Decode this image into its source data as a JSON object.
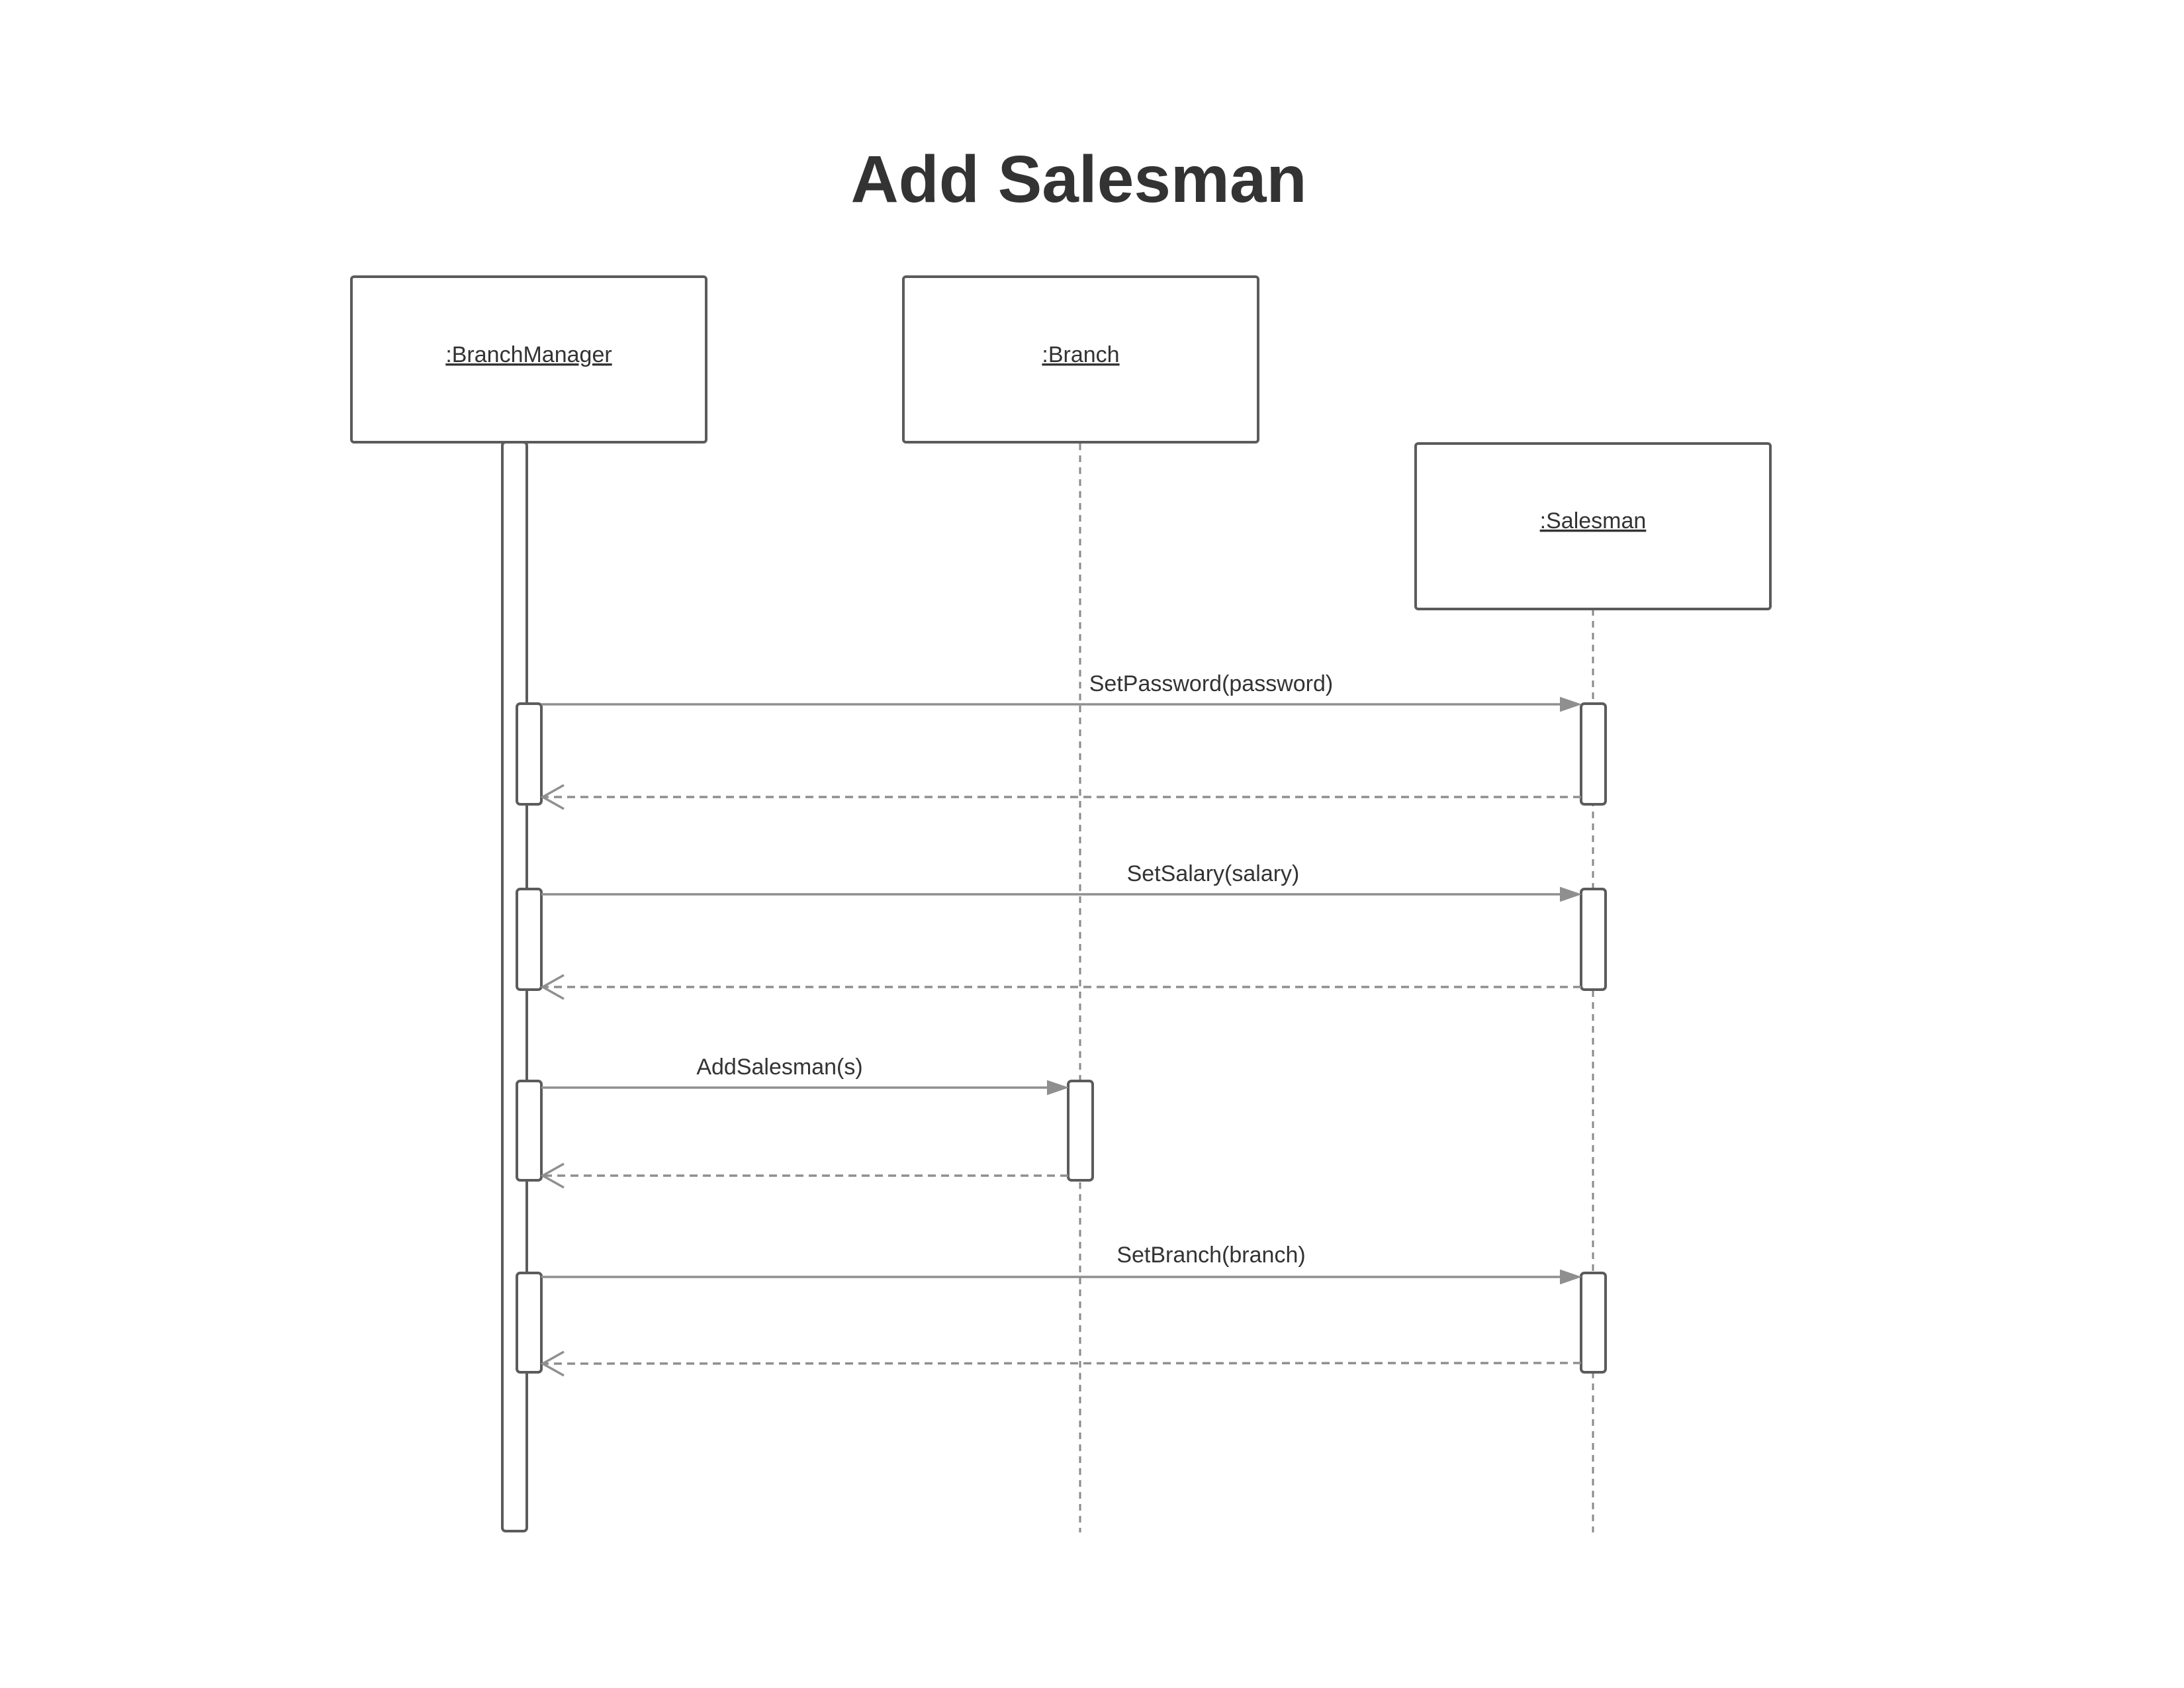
{
  "title": "Add Salesman",
  "participants": [
    {
      "id": "bm",
      "label": ":BranchManager"
    },
    {
      "id": "br",
      "label": ":Branch"
    },
    {
      "id": "sm",
      "label": ":Salesman"
    }
  ],
  "messages": [
    {
      "from": "bm",
      "to": "sm",
      "label": "SetPassword(password)",
      "returns": true
    },
    {
      "from": "bm",
      "to": "sm",
      "label": "SetSalary(salary)",
      "returns": true
    },
    {
      "from": "bm",
      "to": "br",
      "label": "AddSalesman(s)",
      "returns": true
    },
    {
      "from": "bm",
      "to": "sm",
      "label": "SetBranch(branch)",
      "returns": true
    }
  ]
}
